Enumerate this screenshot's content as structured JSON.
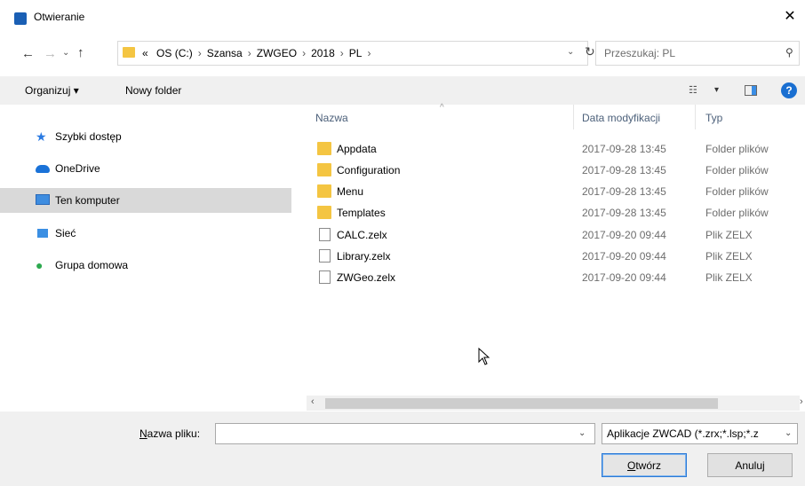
{
  "window": {
    "title": "Otwieranie",
    "close_glyph": "✕"
  },
  "address_bar": {
    "overflow": "«",
    "path": [
      "OS (C:)",
      "Szansa",
      "ZWGEO",
      "2018",
      "PL"
    ],
    "separator": "›"
  },
  "search": {
    "placeholder": "Przeszukaj: PL"
  },
  "toolbar": {
    "organize_label": "Organizuj ▾",
    "new_folder_label": "Nowy folder"
  },
  "sidebar": {
    "items": [
      {
        "label": "Szybki dostęp",
        "icon": "star-icon"
      },
      {
        "label": "OneDrive",
        "icon": "cloud-icon"
      },
      {
        "label": "Ten komputer",
        "icon": "computer-icon",
        "selected": true
      },
      {
        "label": "Sieć",
        "icon": "network-icon"
      },
      {
        "label": "Grupa domowa",
        "icon": "homegroup-icon"
      }
    ]
  },
  "columns": {
    "name": "Nazwa",
    "date": "Data modyfikacji",
    "type": "Typ"
  },
  "files": [
    {
      "name": "Appdata",
      "date": "2017-09-28 13:45",
      "type": "Folder plików",
      "kind": "folder"
    },
    {
      "name": "Configuration",
      "date": "2017-09-28 13:45",
      "type": "Folder plików",
      "kind": "folder"
    },
    {
      "name": "Menu",
      "date": "2017-09-28 13:45",
      "type": "Folder plików",
      "kind": "folder"
    },
    {
      "name": "Templates",
      "date": "2017-09-28 13:45",
      "type": "Folder plików",
      "kind": "folder"
    },
    {
      "name": "CALC.zelx",
      "date": "2017-09-20 09:44",
      "type": "Plik ZELX",
      "kind": "file"
    },
    {
      "name": "Library.zelx",
      "date": "2017-09-20 09:44",
      "type": "Plik ZELX",
      "kind": "file"
    },
    {
      "name": "ZWGeo.zelx",
      "date": "2017-09-20 09:44",
      "type": "Plik ZELX",
      "kind": "file"
    }
  ],
  "bottom": {
    "filename_label_prefix": "N",
    "filename_label_rest": "azwa pliku:",
    "filename_value": "",
    "filter_value": "Aplikacje ZWCAD (*.zrx;*.lsp;*.z",
    "open_prefix": "O",
    "open_rest": "twórz",
    "cancel_label": "Anuluj"
  },
  "colors": {
    "accent": "#1a6fd1",
    "folder": "#f4c542",
    "selection": "#d9d9d9"
  }
}
